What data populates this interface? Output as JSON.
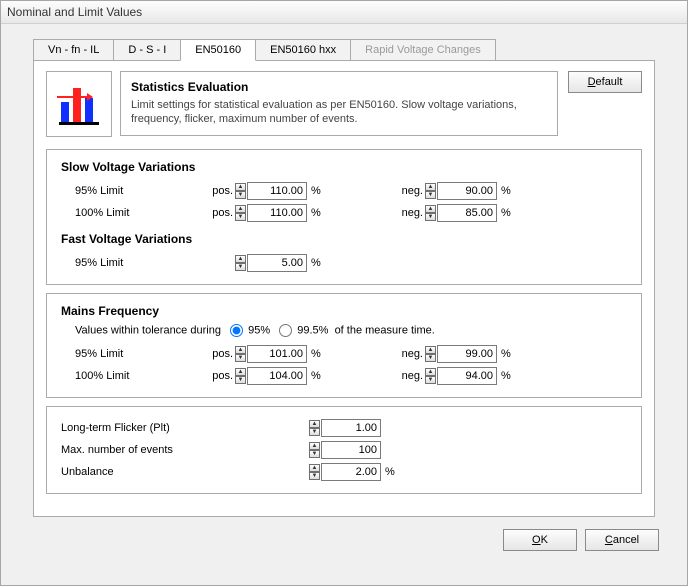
{
  "title": "Nominal and Limit Values",
  "tabs": [
    "Vn - fn - IL",
    "D - S - I",
    "EN50160",
    "EN50160 hxx",
    "Rapid Voltage Changes"
  ],
  "activeTab": 2,
  "disabledTabs": [
    4
  ],
  "defaultButton": "Default",
  "description": {
    "title": "Statistics Evaluation",
    "text": "Limit settings for statistical evaluation as per EN50160. Slow voltage variations, frequency, flicker, maximum number of events."
  },
  "labels": {
    "slowHeader": "Slow Voltage Variations",
    "fastHeader": "Fast Voltage Variations",
    "mainsHeader": "Mains Frequency",
    "limit95": "95% Limit",
    "limit100": "100% Limit",
    "pos": "pos.",
    "neg": "neg.",
    "pct": "%",
    "tolPrefix": "Values within tolerance during",
    "tol95": "95%",
    "tol995": "99.5%",
    "tolSuffix": "of the measure time.",
    "flicker": "Long-term Flicker (Plt)",
    "maxEvents": "Max. number of events",
    "unbalance": "Unbalance"
  },
  "values": {
    "slow95pos": "110.00",
    "slow95neg": "90.00",
    "slow100pos": "110.00",
    "slow100neg": "85.00",
    "fast95": "5.00",
    "tolSel": "95",
    "mains95pos": "101.00",
    "mains95neg": "99.00",
    "mains100pos": "104.00",
    "mains100neg": "94.00",
    "flicker": "1.00",
    "maxEvents": "100",
    "unbalance": "2.00"
  },
  "buttons": {
    "ok": "OK",
    "cancel": "Cancel"
  }
}
